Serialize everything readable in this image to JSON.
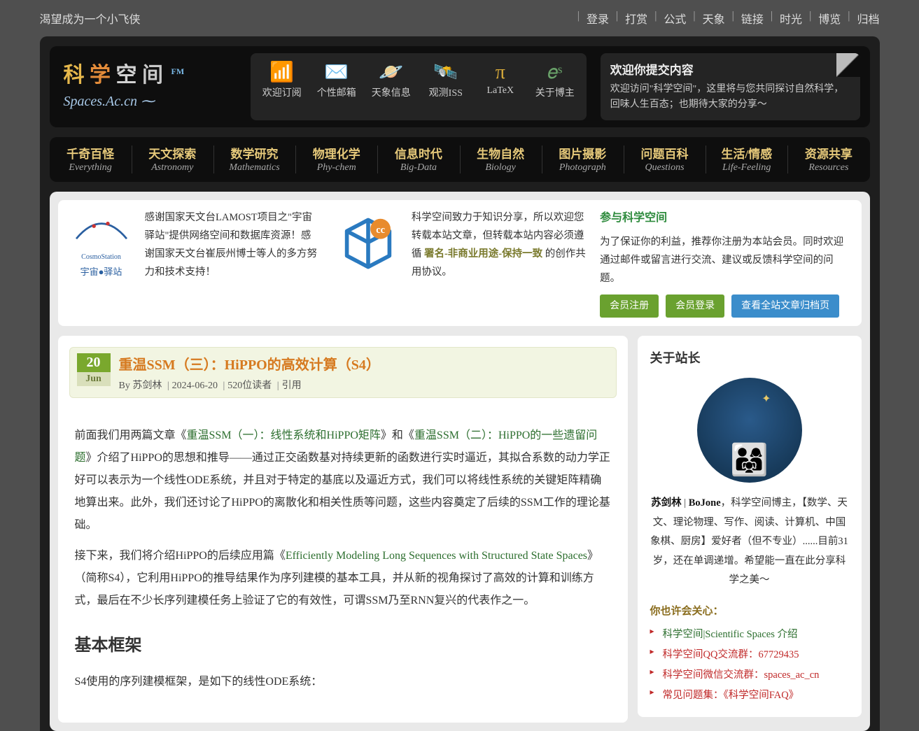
{
  "tagline": "渴望成为一个小飞侠",
  "topnav": [
    "登录",
    "打赏",
    "公式",
    "天象",
    "链接",
    "时光",
    "博览",
    "归档"
  ],
  "logo": {
    "cn": [
      "科",
      "学",
      "空",
      "间"
    ],
    "fm": "FM",
    "sub": "Spaces.Ac.cn ⁓"
  },
  "icons": [
    {
      "glyph": "📶",
      "label": "欢迎订阅",
      "color": "#e88b2d"
    },
    {
      "glyph": "✉️",
      "label": "个性邮箱",
      "color": "#5a8ed6"
    },
    {
      "glyph": "🪐",
      "label": "天象信息",
      "color": "#d4a24c"
    },
    {
      "glyph": "🛰️",
      "label": "观测ISS",
      "color": "#c94b6b"
    },
    {
      "glyph": "π",
      "label": "LaTeX",
      "color": "#d6a93a"
    },
    {
      "glyph": "𝑒ˢ",
      "label": "关于博主",
      "color": "#6aa36a"
    }
  ],
  "welcome": {
    "title": "欢迎你提交内容",
    "body": "欢迎访问\"科学空间\"，这里将与您共同探讨自然科学，回味人生百态；也期待大家的分享～"
  },
  "mainnav": [
    {
      "cn": "千奇百怪",
      "en": "Everything"
    },
    {
      "cn": "天文探索",
      "en": "Astronomy"
    },
    {
      "cn": "数学研究",
      "en": "Mathematics"
    },
    {
      "cn": "物理化学",
      "en": "Phy-chem"
    },
    {
      "cn": "信息时代",
      "en": "Big-Data"
    },
    {
      "cn": "生物自然",
      "en": "Biology"
    },
    {
      "cn": "图片摄影",
      "en": "Photograph"
    },
    {
      "cn": "问题百科",
      "en": "Questions"
    },
    {
      "cn": "生活/情感",
      "en": "Life-Feeling"
    },
    {
      "cn": "资源共享",
      "en": "Resources"
    }
  ],
  "intro1": "感谢国家天文台LAMOST项目之\"宇宙驿站\"提供网络空间和数据库资源！感谢国家天文台崔辰州博士等人的多方努力和技术支持！",
  "intro2_a": "科学空间致力于知识分享，所以欢迎您转载本站文章，但转载本站内容必须遵循 ",
  "intro2_link": "署名-非商业用途-保持一致",
  "intro2_b": " 的创作共用协议。",
  "intro3": {
    "title": "参与科学空间",
    "body": "为了保证你的利益，推荐你注册为本站会员。同时欢迎通过邮件或留言进行交流、建议或反馈科学空间的问题。",
    "btns": [
      "会员注册",
      "会员登录",
      "查看全站文章归档页"
    ]
  },
  "cosmo": {
    "line1": "CosmoStation",
    "line2": "宇宙●驿站"
  },
  "post": {
    "day": "20",
    "mon": "Jun",
    "title": "重温SSM（三）：HiPPO的高效计算（S4）",
    "meta_by": "By ",
    "author": "苏剑林",
    "date": "2024-06-20",
    "readers": "520位读者",
    "cite": "引用",
    "p1_a": "前面我们用两篇文章《",
    "p1_l1": "重温SSM（一）：线性系统和HiPPO矩阵",
    "p1_b": "》和《",
    "p1_l2": "重温SSM（二）：HiPPO的一些遗留问题",
    "p1_c": "》介绍了HiPPO的思想和推导——通过正交函数基对持续更新的函数进行实时逼近，其拟合系数的动力学正好可以表示为一个线性ODE系统，并且对于特定的基底以及逼近方式，我们可以将线性系统的关键矩阵精确地算出来。此外，我们还讨论了HiPPO的离散化和相关性质等问题，这些内容奠定了后续的SSM工作的理论基础。",
    "p2_a": "接下来，我们将介绍HiPPO的后续应用篇《",
    "p2_l": "Efficiently Modeling Long Sequences with Structured State Spaces",
    "p2_b": "》（简称S4），它利用HiPPO的推导结果作为序列建模的基本工具，并从新的视角探讨了高效的计算和训练方式，最后在不少长序列建模任务上验证了它的有效性，可谓SSM乃至RNN复兴的代表作之一。",
    "h3": "基本框架",
    "p3": "S4使用的序列建模框架，是如下的线性ODE系统："
  },
  "about": {
    "title": "关于站长",
    "bio_a": "苏剑林",
    "bio_b": "BoJone",
    "bio_c": "，科学空间博主，【数学、天文、理论物理、写作、阅读、计算机、中国象棋、厨房】爱好者（但不专业）......目前31岁，还在单调递增。希望能一直在此分享科学之美～",
    "rel_h": "你也许会关心：",
    "rel": [
      {
        "txt": "科学空间|Scientific Spaces 介绍",
        "cls": "g"
      },
      {
        "txt": "科学空间QQ交流群：67729435",
        "cls": "r"
      },
      {
        "txt": "科学空间微信交流群：spaces_ac_cn",
        "cls": "r"
      },
      {
        "txt": "常见问题集：《科学空间FAQ》",
        "cls": "r"
      }
    ]
  }
}
